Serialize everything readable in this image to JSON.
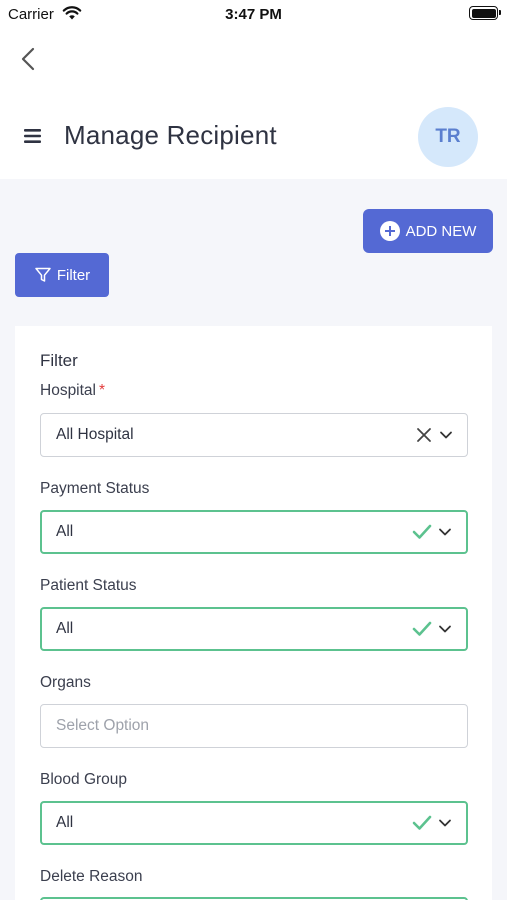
{
  "status_bar": {
    "carrier": "Carrier",
    "time": "3:47 PM"
  },
  "header": {
    "title": "Manage Recipient",
    "avatar_initials": "TR"
  },
  "actions": {
    "add_new_label": "ADD NEW",
    "filter_label": "Filter"
  },
  "filter_panel": {
    "title": "Filter",
    "fields": [
      {
        "label": "Hospital",
        "required_mark": "*",
        "value": "All Hospital"
      },
      {
        "label": "Payment Status",
        "value": "All"
      },
      {
        "label": "Patient Status",
        "value": "All"
      },
      {
        "label": "Organs",
        "placeholder": "Select Option"
      },
      {
        "label": "Blood Group",
        "value": "All"
      },
      {
        "label": "Delete Reason"
      }
    ]
  },
  "colors": {
    "primary": "#5469d4",
    "valid": "#5cc28f",
    "required": "#e23b3b",
    "avatar_bg": "#d5e8fb"
  }
}
